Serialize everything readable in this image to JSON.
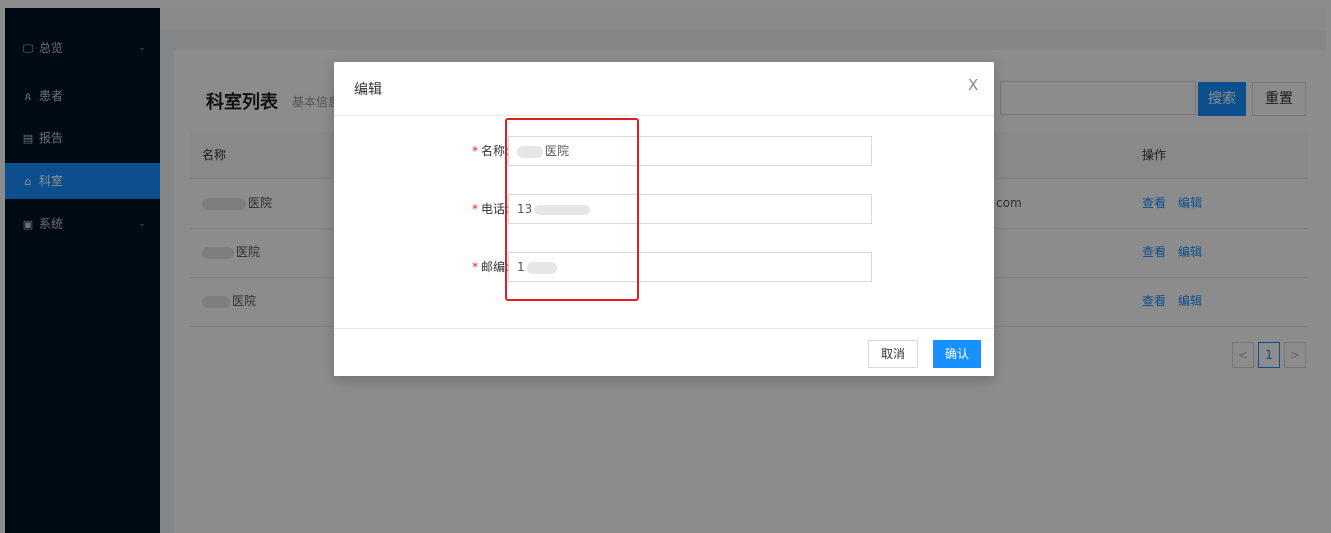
{
  "sidebar": {
    "items": [
      {
        "icon": "monitor-icon",
        "glyph": "🖵",
        "label": "总览",
        "arrow": "⌄",
        "active": false
      },
      {
        "icon": "user-icon",
        "glyph": "ጰ",
        "label": "患者",
        "active": false
      },
      {
        "icon": "report-icon",
        "glyph": "▤",
        "label": "报告",
        "active": false
      },
      {
        "icon": "home-icon",
        "glyph": "⌂",
        "label": "科室",
        "active": true
      },
      {
        "icon": "system-icon",
        "glyph": "▣",
        "label": "系统",
        "arrow": "⌄",
        "active": false
      }
    ]
  },
  "card": {
    "title": "科室列表",
    "subtitle": "基本信息",
    "search_button": "搜索",
    "reset_button": "重置"
  },
  "table": {
    "headers": {
      "name": "名称",
      "actions": "操作"
    },
    "rows": [
      {
        "name": "医院",
        "email_suffix": "com",
        "view": "查看",
        "edit": "编辑"
      },
      {
        "name": "医院",
        "email_suffix": "",
        "view": "查看",
        "edit": "编辑"
      },
      {
        "name": "医院",
        "email_suffix": "",
        "view": "查看",
        "edit": "编辑"
      }
    ]
  },
  "pagination": {
    "prev": "<",
    "current": "1",
    "next": ">"
  },
  "modal": {
    "title": "编辑",
    "close": "X",
    "fields": [
      {
        "required_mark": "*",
        "label": "名称:",
        "value": "医院"
      },
      {
        "required_mark": "*",
        "label": "电话:",
        "value": "13"
      },
      {
        "required_mark": "*",
        "label": "邮编:",
        "value": "1"
      }
    ],
    "cancel_button": "取消",
    "ok_button": "确认"
  },
  "colors": {
    "sidebar_bg": "#001529",
    "primary": "#1890ff",
    "required": "#f5222d",
    "highlight": "#e02020"
  }
}
